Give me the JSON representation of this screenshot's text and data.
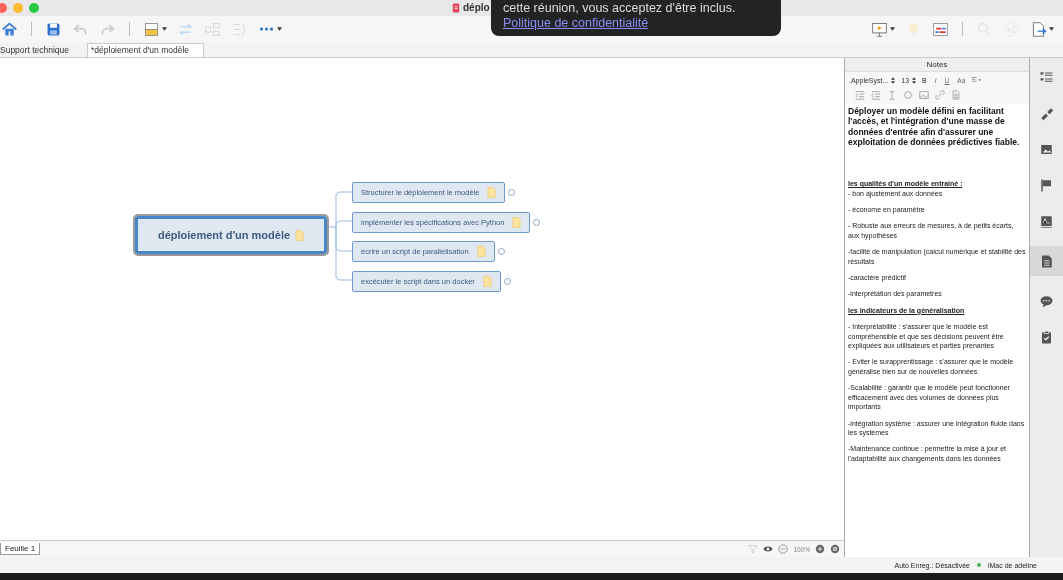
{
  "window": {
    "title": "déplo"
  },
  "toolbar": {
    "left": [
      {
        "kind": "button",
        "disabled": false
      },
      {
        "kind": "separator"
      },
      {
        "kind": "button",
        "disabled": false
      },
      {
        "kind": "button",
        "disabled": true
      },
      {
        "kind": "button",
        "disabled": true
      },
      {
        "kind": "separator"
      },
      {
        "kind": "menubutton",
        "disabled": false
      },
      {
        "kind": "button",
        "disabled": true
      },
      {
        "kind": "button",
        "disabled": true
      },
      {
        "kind": "button",
        "disabled": true
      },
      {
        "kind": "menubutton",
        "disabled": false
      }
    ],
    "right": [
      {
        "kind": "menubutton",
        "disabled": false
      },
      {
        "kind": "button",
        "disabled": true
      },
      {
        "kind": "button",
        "disabled": false
      },
      {
        "kind": "separator"
      },
      {
        "kind": "button",
        "disabled": true
      },
      {
        "kind": "button",
        "disabled": true
      },
      {
        "kind": "menubutton",
        "disabled": false
      }
    ]
  },
  "popup": {
    "text": "cette réunion, vous acceptez d'être inclus.",
    "link": "Politique de confidentialité"
  },
  "tabs": [
    {
      "label": "Support technique",
      "selected": false
    },
    {
      "label": "*déploiement d'un modèle",
      "selected": true
    }
  ],
  "mindmap": {
    "central": {
      "label": "déploiement d'un modèle",
      "has_note": true
    },
    "topics": [
      {
        "label": "Structurer le déploiement  le modèle",
        "has_note": true
      },
      {
        "label": "implémenter les spécifications avec Python",
        "has_note": true
      },
      {
        "label": "écrire un script de parallelisation",
        "has_note": true
      },
      {
        "label": "excécuter le script dans un docker",
        "has_note": true
      }
    ]
  },
  "notes": {
    "title": "Notes",
    "font": ".AppleSyst...",
    "size": "13",
    "format_buttons": [
      "B",
      "I",
      "U",
      "Aa"
    ],
    "paragraphs": [
      {
        "kind": "lead",
        "text": "Déployer un modèle défini en facilitant l'accès, et l'intégration  d'une masse de données d'entrée afin d'assurer une exploitation de données prédictives fiable."
      },
      {
        "kind": "subheading",
        "text": "les qualités d'un modèle entrainé :"
      },
      {
        "kind": "text",
        "text": "- bon ajustement aux données"
      },
      {
        "kind": "text",
        "text": "- économe en paramètre"
      },
      {
        "kind": "text",
        "text": "- Robuste aux erreurs de mesures, à de petits écarts, aux hypothèses"
      },
      {
        "kind": "text",
        "text": "-facilité de manipulation (calcul numérique et stabilité des résultats"
      },
      {
        "kind": "text",
        "text": "-caractère prédictif"
      },
      {
        "kind": "text",
        "text": "-interprétation des parametres"
      },
      {
        "kind": "heading",
        "text": "les indicateurs  de la généralisation"
      },
      {
        "kind": "text",
        "text": "- Interprétabilité : s'assurer que le modèle est compréhensible et que ses décisions peuvent être expliquées aux utilisateurs et parties prenantes"
      },
      {
        "kind": "text",
        "text": "- Eviter le surapprentissage : s'assurer que le modèle généralise bien sur de nouvelles données"
      },
      {
        "kind": "text",
        "text": "-Scalabilité : garantir que le modèle peut fonctionner efficacement avec des volumes de données plus importants"
      },
      {
        "kind": "text",
        "text": "-intégration système : assurer une intégration fluide dans les systèmes"
      },
      {
        "kind": "text",
        "text": "-Maintenance continue : permettre la mise à jour et l'adaptabilité aux changements dans les données"
      }
    ]
  },
  "side_rail": [
    {
      "selected": false
    },
    {
      "selected": false
    },
    {
      "selected": false
    },
    {
      "selected": false
    },
    {
      "selected": false
    },
    {
      "selected": true
    },
    {
      "selected": false
    },
    {
      "selected": false
    }
  ],
  "sheet_tabs": [
    {
      "label": "Feuille 1",
      "selected": true
    }
  ],
  "zoom": {
    "value": "100%"
  },
  "status_bar": {
    "autosave": "Auto Enreg.: Désactivée",
    "device": "iMac de adeline"
  }
}
